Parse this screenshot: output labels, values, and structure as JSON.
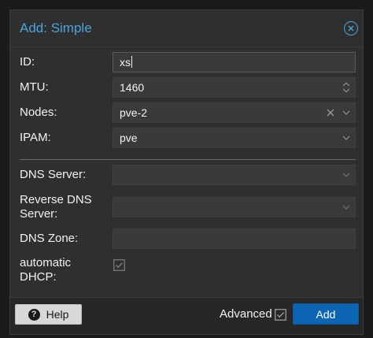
{
  "window": {
    "title": "Add: Simple"
  },
  "form": {
    "id": {
      "label": "ID:",
      "value": "xs"
    },
    "mtu": {
      "label": "MTU:",
      "value": "1460"
    },
    "nodes": {
      "label": "Nodes:",
      "value": "pve-2"
    },
    "ipam": {
      "label": "IPAM:",
      "value": "pve"
    },
    "dns_server": {
      "label": "DNS Server:",
      "value": ""
    },
    "reverse_dns_server": {
      "label_line1": "Reverse DNS",
      "label_line2": "Server:",
      "value": ""
    },
    "dns_zone": {
      "label": "DNS Zone:",
      "value": ""
    },
    "automatic_dhcp": {
      "label_line1": "automatic",
      "label_line2": "DHCP:",
      "checked": false
    }
  },
  "footer": {
    "help_label": "Help",
    "advanced_label": "Advanced",
    "advanced_checked": false,
    "add_label": "Add"
  },
  "colors": {
    "accent": "#4aa3df",
    "primary_button": "#0c66b3",
    "dialog_bg": "#2f2f2f",
    "field_bg": "#3a3a3a"
  },
  "icons": {
    "close": "close-circle-icon",
    "spinner": "spinner-arrows-icon",
    "clear": "clear-x-icon",
    "dropdown": "chevron-down-icon",
    "checkbox": "checkbox-icon",
    "help": "question-circle-icon"
  }
}
